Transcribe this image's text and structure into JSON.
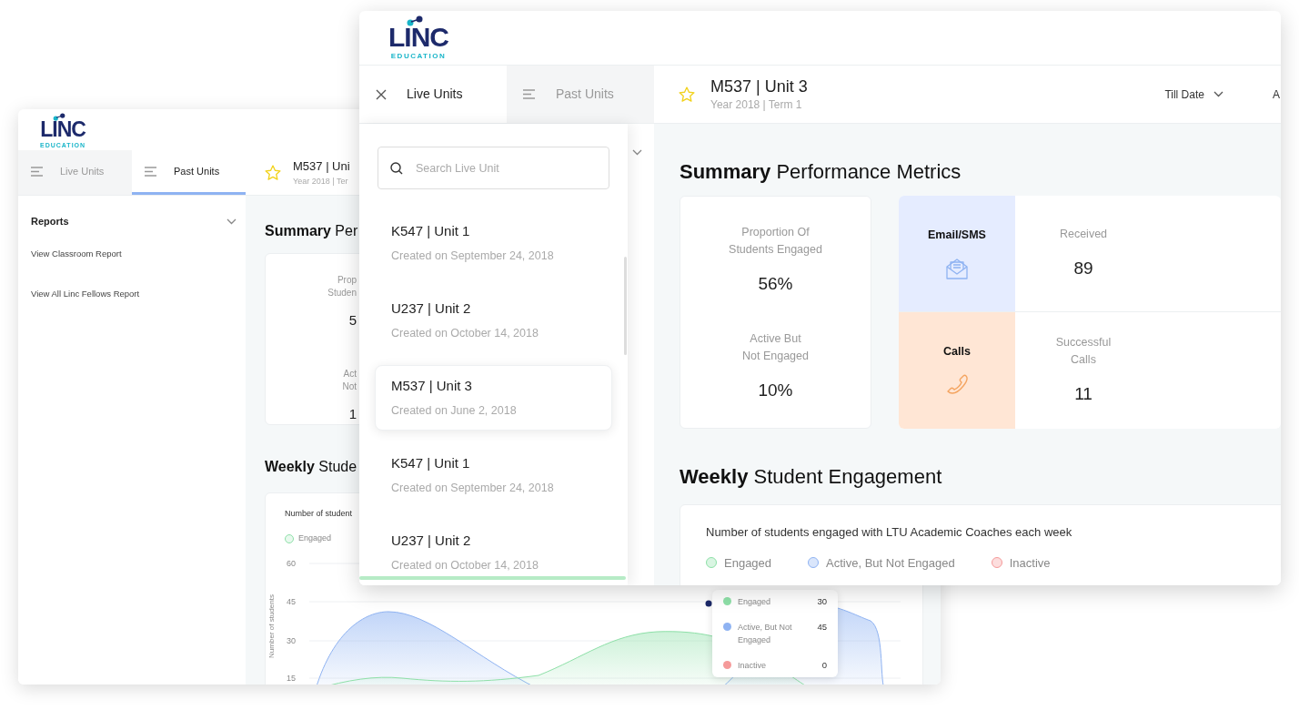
{
  "back_window": {
    "logo": {
      "wordmark": "LINC",
      "tagline": "EDUCATION"
    },
    "tabs": [
      {
        "label": "Live Units",
        "selected": false
      },
      {
        "label": "Past Units",
        "selected": true
      }
    ],
    "unit": {
      "title": "M537 | Uni",
      "subtitle": "Year 2018 | Ter"
    },
    "sidebar": {
      "section": "Reports",
      "items": [
        "View Classroom Report",
        "View All Linc Fellows Report"
      ]
    },
    "summary_heading": "**Summary** Per",
    "metrics": [
      {
        "label_lines": [
          "Prop",
          "Studen"
        ],
        "value": "5"
      },
      {
        "label_lines": [
          "Act",
          "Not"
        ],
        "value": "1"
      }
    ],
    "weekly_heading": "**Weekly** Stude",
    "chart": {
      "subtitle": "Number of student",
      "legend": [
        {
          "label": "Engaged",
          "color": "#8ee0a8"
        }
      ],
      "ylabel": "Number of students",
      "y_ticks": [
        "60",
        "45",
        "30",
        "15"
      ],
      "tooltip": [
        {
          "label": "Engaged",
          "value": "30",
          "color": "#8ee0a8"
        },
        {
          "label": "Active, But Not Engaged",
          "value": "45",
          "color": "#8fb3f2"
        },
        {
          "label": "Inactive",
          "value": "0",
          "color": "#f59a9a"
        }
      ]
    }
  },
  "front_window": {
    "logo": {
      "wordmark": "LINC",
      "tagline": "EDUCATION"
    },
    "tabs": [
      {
        "label": "Live Units",
        "selected": true,
        "kind": "close"
      },
      {
        "label": "Past Units",
        "selected": false,
        "kind": "menu"
      }
    ],
    "unit": {
      "title": "M537 | Unit 3",
      "subtitle": "Year 2018 | Term 1"
    },
    "period_filter": "Till Date",
    "next_filter": "A",
    "drawer": {
      "search": {
        "placeholder": "Search Live Unit"
      },
      "units": [
        {
          "title": "K547 | Unit 1",
          "created": "Created on September 24, 2018",
          "selected": false
        },
        {
          "title": "U237 | Unit 2",
          "created": "Created on October 14, 2018",
          "selected": false
        },
        {
          "title": "M537 | Unit 3",
          "created": "Created on June 2, 2018",
          "selected": true
        },
        {
          "title": "K547 | Unit 1",
          "created": "Created on September 24, 2018",
          "selected": false
        },
        {
          "title": "U237 | Unit 2",
          "created": "Created on October 14, 2018",
          "selected": false
        }
      ]
    },
    "summary_heading": "**Summary** Performance Metrics",
    "metrics": [
      {
        "label_lines": [
          "Proportion Of",
          "Students Engaged"
        ],
        "value": "56%"
      },
      {
        "label_lines": [
          "Active But",
          "Not Engaged"
        ],
        "value": "10%"
      }
    ],
    "channels": [
      {
        "name": "Email/SMS",
        "kind": "email",
        "color": "#e5ecff",
        "label_lines": [
          "Received"
        ],
        "value": "89"
      },
      {
        "name": "Calls",
        "kind": "calls",
        "color": "#ffe6d5",
        "label_lines": [
          "Successful",
          "Calls"
        ],
        "value": "11"
      }
    ],
    "weekly_heading": "**Weekly** Student Engagement",
    "chart": {
      "subtitle": "Number of students engaged with LTU Academic Coaches each week",
      "legend": [
        {
          "label": "Engaged",
          "color": "#8ee0a8"
        },
        {
          "label": "Active, But Not Engaged",
          "color": "#8fb3f2"
        },
        {
          "label": "Inactive",
          "color": "#f59a9a"
        }
      ]
    }
  }
}
